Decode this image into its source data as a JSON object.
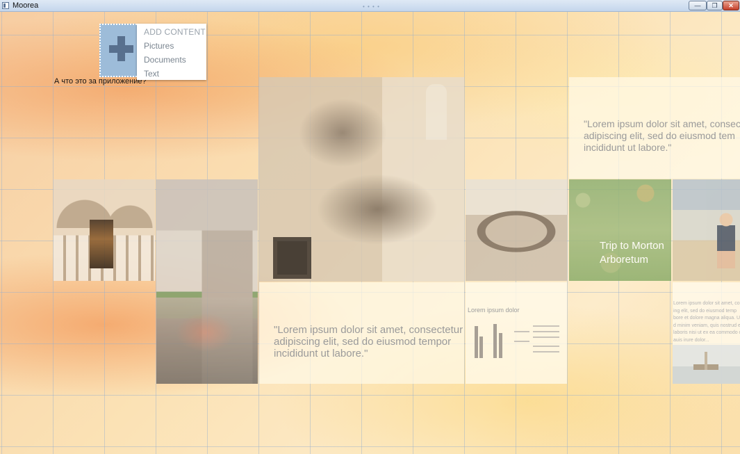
{
  "window": {
    "title": "Moorea",
    "minimize_glyph": "—",
    "maximize_glyph": "❐",
    "close_glyph": "✕",
    "grip_glyph": "• • • •"
  },
  "add_menu": {
    "header": "ADD CONTENT",
    "items": [
      "Pictures",
      "Documents",
      "Text"
    ]
  },
  "question": "А что это за приложение?",
  "tiles": {
    "quote_top": {
      "lines": [
        "\"Lorem ipsum dolor sit amet, consect",
        "adipiscing elit, sed do eiusmod tem",
        "incididunt ut labore.\""
      ]
    },
    "quote_mid": {
      "lines": [
        "\"Lorem ipsum dolor sit amet, consectetur",
        "adipiscing elit, sed do eiusmod tempor",
        "incididunt ut labore.\""
      ]
    },
    "arboretum": {
      "lines": [
        "Trip to Morton",
        "Arboretum"
      ]
    },
    "chart_tile": {
      "title": "Lorem ipsum dolor"
    },
    "text_tile": {
      "lines": [
        "Lorem ipsum dolor sit amet, co",
        "ing elit, sed do eiusmod temp",
        "bore et dolore magna aliqua. U",
        "d minim veniam, quis nostrud exe",
        "laboris nisi ut ex ea commodo c",
        "auis irure dolor..."
      ]
    }
  },
  "colors": {
    "add_tile": "#9dbcd9",
    "plus_icon": "#58708e",
    "grid_line": "#96afcd",
    "quote_text": "#9a9a9a"
  },
  "icons": {
    "add": "plus-icon",
    "app": "app-window-icon"
  }
}
